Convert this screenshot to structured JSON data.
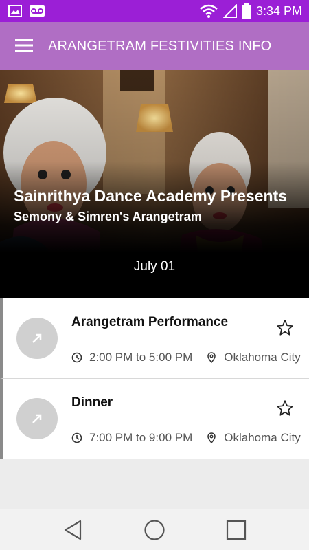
{
  "status_bar": {
    "time": "3:34 PM",
    "icons": [
      "image-icon",
      "voicemail-icon",
      "wifi-icon",
      "signal-icon",
      "battery-icon"
    ]
  },
  "app_bar": {
    "title": "ARANGETRAM FESTIVITIES INFO",
    "menu_icon": "hamburger-menu-icon"
  },
  "hero": {
    "title": "Sainrithya Dance Academy Presents",
    "subtitle": "Semony & Simren's Arangetram",
    "date": "July 01"
  },
  "events": [
    {
      "name": "Arangetram Performance",
      "time": "2:00 PM to 5:00 PM",
      "location": "Oklahoma City",
      "icon": "arrow-up-right-icon",
      "favorite_icon": "star-outline-icon"
    },
    {
      "name": "Dinner",
      "time": "7:00 PM to 9:00 PM",
      "location": "Oklahoma City",
      "icon": "arrow-up-right-icon",
      "favorite_icon": "star-outline-icon"
    }
  ],
  "nav_bar": {
    "buttons": [
      "back-triangle-icon",
      "home-circle-icon",
      "recents-square-icon"
    ]
  },
  "colors": {
    "status_bar": "#9b1fd6",
    "app_bar": "#b06ec4",
    "background": "#ececec"
  }
}
